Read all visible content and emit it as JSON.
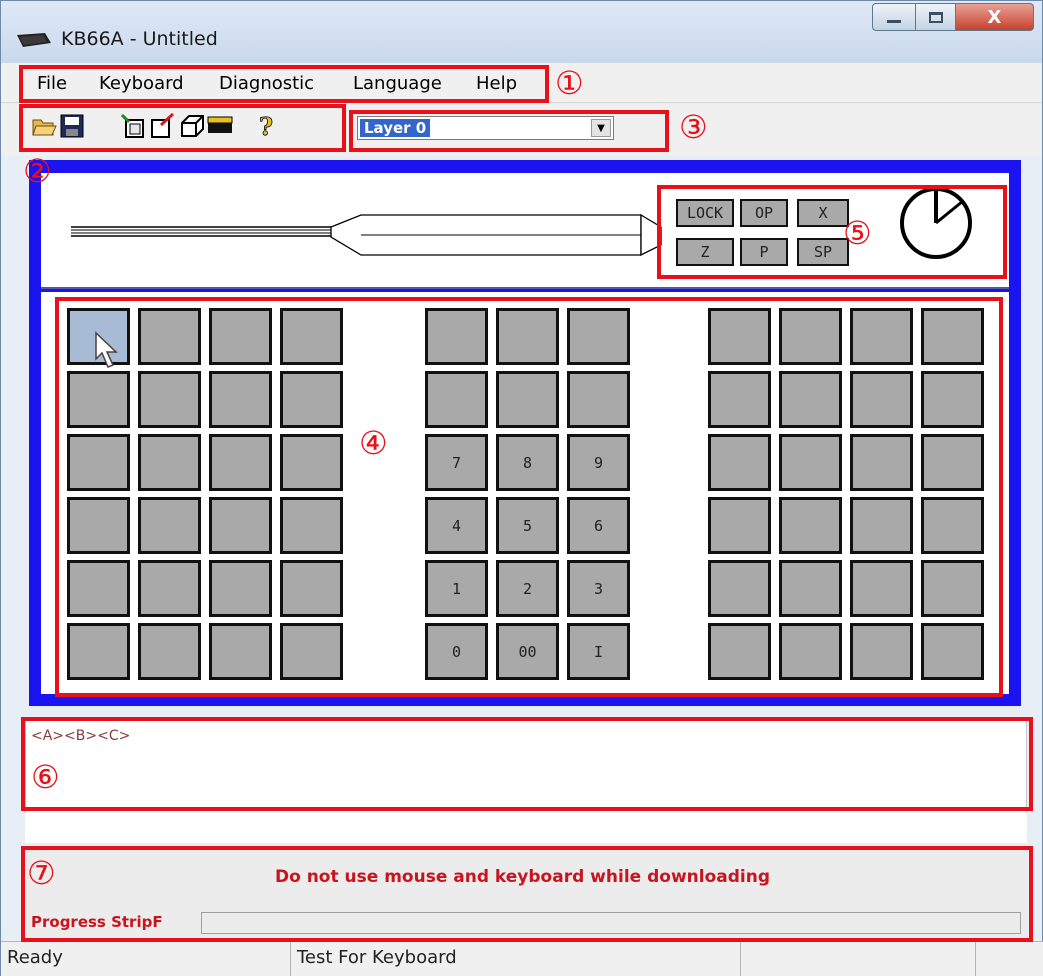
{
  "window": {
    "title": "KB66A - Untitled",
    "close_label": "X"
  },
  "menu": {
    "items": [
      "File",
      "Keyboard",
      "Diagnostic",
      "Language",
      "Help"
    ]
  },
  "toolbar": {
    "icons": [
      "open-folder-icon",
      "save-icon",
      "new-layout-icon",
      "edit-key-icon",
      "3d-box-icon",
      "download-icon",
      "help-icon"
    ],
    "layer_select": {
      "value": "Layer 0"
    }
  },
  "function_keys": {
    "row1": [
      "LOCK",
      "OP",
      "X"
    ],
    "row2": [
      "Z",
      "P",
      "SP"
    ]
  },
  "keypad": {
    "center_labels": [
      "",
      "",
      "",
      "",
      "",
      "",
      "7",
      "8",
      "9",
      "4",
      "5",
      "6",
      "1",
      "2",
      "3",
      "0",
      "00",
      "I"
    ]
  },
  "text_panel": {
    "content": "<A><B><C>"
  },
  "download": {
    "message": "Do not use mouse and keyboard while downloading",
    "progress_label": "Progress StripF",
    "progress": 0
  },
  "status": {
    "cells": [
      "Ready",
      "Test For Keyboard",
      "",
      ""
    ]
  },
  "annotations": [
    "①",
    "②",
    "③",
    "④",
    "⑤",
    "⑥",
    "⑦"
  ],
  "colors": {
    "accent_blue": "#1a14f0",
    "annotation_red": "#e8101a",
    "key_gray": "#a9a9a9"
  }
}
